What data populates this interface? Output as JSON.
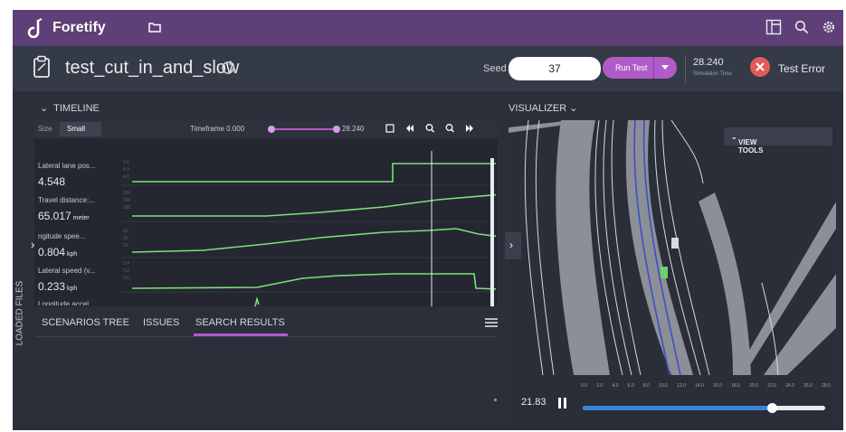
{
  "app": {
    "brand": "Foretify"
  },
  "header": {
    "test_name": "test_cut_in_and_slow",
    "seed_label": "Seed",
    "seed_value": "37",
    "run_button": "Run Test",
    "simulation_time": "28.240",
    "simulation_time_label": "Simulation Time",
    "status": "Test Error",
    "status_color": "#e25a5a"
  },
  "side": {
    "loaded_files": "LOADED FILES"
  },
  "timeline": {
    "title": "TIMELINE",
    "size_label": "Size",
    "size_value": "Small",
    "timeframe_label": "Timeframe",
    "timeframe_start": "0.000",
    "timeframe_end": "28.240",
    "rows": [
      {
        "label": "Lateral lane pos...",
        "value": "4.548",
        "unit": ""
      },
      {
        "label": "Travel distance:...",
        "value": "65.017",
        "unit": "meter"
      },
      {
        "label": "ngitude spee...",
        "value": "0.804",
        "unit": "kph"
      },
      {
        "label": "Lateral speed (v...",
        "value": "0.233",
        "unit": "kph"
      },
      {
        "label": "Longitude accel...",
        "value": "",
        "unit": ""
      }
    ]
  },
  "tabs": {
    "scenarios": "SCENARIOS TREE",
    "issues": "ISSUES",
    "search": "SEARCH RESULTS"
  },
  "visualizer": {
    "title": "VISUALIZER",
    "view_tools": "VIEW TOOLS",
    "player": {
      "current_time": "21.83",
      "progress": 0.78,
      "ticks": [
        "0.0",
        "2.0",
        "4.0",
        "6.0",
        "8.0",
        "10.0",
        "12.0",
        "14.0",
        "16.0",
        "18.0",
        "20.0",
        "22.0",
        "24.0",
        "26.0",
        "28.0"
      ]
    }
  },
  "colors": {
    "accent": "#b05cc8",
    "topbar": "#5f3f78",
    "signal": "#7be07a",
    "slider": "#3d82d6"
  }
}
